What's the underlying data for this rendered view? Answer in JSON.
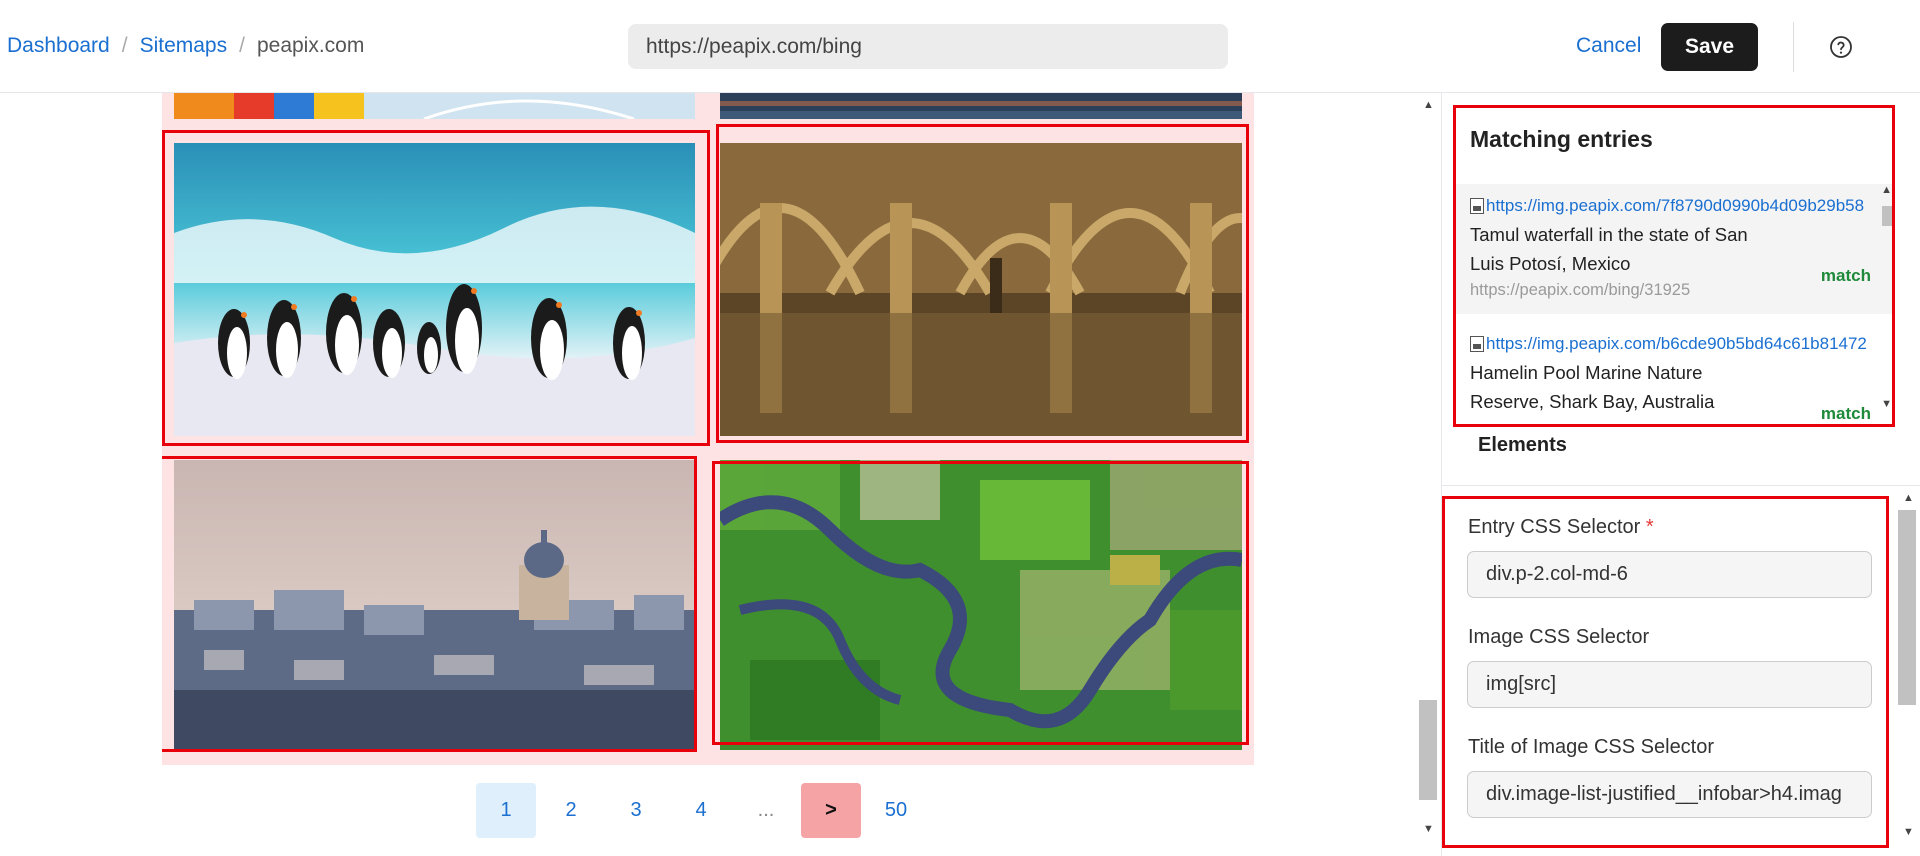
{
  "breadcrumb": {
    "items": [
      "Dashboard",
      "Sitemaps",
      "peapix.com"
    ],
    "sep": "/"
  },
  "toolbar": {
    "url_value": "https://peapix.com/bing",
    "cancel_label": "Cancel",
    "save_label": "Save"
  },
  "icons": {
    "help": "help-circle-icon",
    "broken_image": "broken-image-icon"
  },
  "colors": {
    "accent_link": "#1a6fd1",
    "highlight_outline": "#e8000b",
    "gallery_bg": "#fde3e3",
    "match_green": "#1f8a3a",
    "save_bg": "#1c1c1c"
  },
  "pagination": {
    "pages": [
      "1",
      "2",
      "3",
      "4",
      "...",
      ">",
      "50"
    ],
    "active": "1"
  },
  "matching": {
    "title": "Matching entries",
    "entries": [
      {
        "src": "https://img.peapix.com/7f8790d0990b4d09b29b58",
        "title": "Tamul waterfall in the state of San Luis Potosí, Mexico",
        "status": "match",
        "page_url": "https://peapix.com/bing/31925"
      },
      {
        "src": "https://img.peapix.com/b6cde90b5bd64c61b81472",
        "title": "Hamelin Pool Marine Nature Reserve, Shark Bay, Australia",
        "status": "match",
        "page_url": ""
      }
    ]
  },
  "elements": {
    "label": "Elements",
    "fields": [
      {
        "label": "Entry CSS Selector",
        "required": "*",
        "value": "div.p-2.col-md-6"
      },
      {
        "label": "Image CSS Selector",
        "value": "img[src]"
      },
      {
        "label": "Title of Image CSS Selector",
        "value": "div.image-list-justified__infobar>h4.imag"
      }
    ]
  }
}
